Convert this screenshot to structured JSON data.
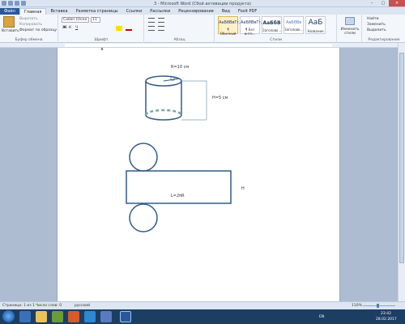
{
  "window": {
    "title": "3 - Microsoft Word (Сбой активации продукта)"
  },
  "tabs": [
    "Файл",
    "Главная",
    "Вставка",
    "Разметка страницы",
    "Ссылки",
    "Рассылки",
    "Рецензирование",
    "Вид",
    "Foxit PDF"
  ],
  "ribbon": {
    "clipboard": {
      "paste": "Вставить",
      "cut": "Вырезать",
      "copy": "Копировать",
      "format_painter": "Формат по образцу",
      "label": "Буфер обмена"
    },
    "font": {
      "name": "Calibri (Осно",
      "size": "11",
      "label": "Шрифт",
      "bold": "Ж",
      "italic": "К",
      "underline": "Ч"
    },
    "paragraph": {
      "label": "Абзац"
    },
    "styles": {
      "label": "Стили",
      "items": [
        {
          "sample": "AaБбВвГг,",
          "name": "¶ Обычный"
        },
        {
          "sample": "AaБбВвГг,",
          "name": "¶ Без инте..."
        },
        {
          "sample": "AaБбВ",
          "name": "Заголово..."
        },
        {
          "sample": "AaБбВв",
          "name": "Заголово..."
        },
        {
          "sample": "AaБ",
          "name": "Название"
        }
      ],
      "change": "Изменить стили"
    },
    "editing": {
      "label": "Редактирование",
      "find": "Найти",
      "replace": "Заменить",
      "select": "Выделить"
    }
  },
  "drawing": {
    "radius_label": "R=10 см",
    "height_label": "H=5 см",
    "length_label": "L=2πR",
    "h_label": "H"
  },
  "status": {
    "page": "Страница: 1 из 1",
    "words": "Число слов: 0",
    "lang": "русский",
    "zoom": "110%"
  },
  "taskbar": {
    "lang": "EN",
    "time": "23:42",
    "date": "28.02.2017"
  },
  "colors": {
    "word_blue": "#2b579a",
    "shape_stroke": "#2f5b8a",
    "dimension": "#7d9ab8"
  }
}
